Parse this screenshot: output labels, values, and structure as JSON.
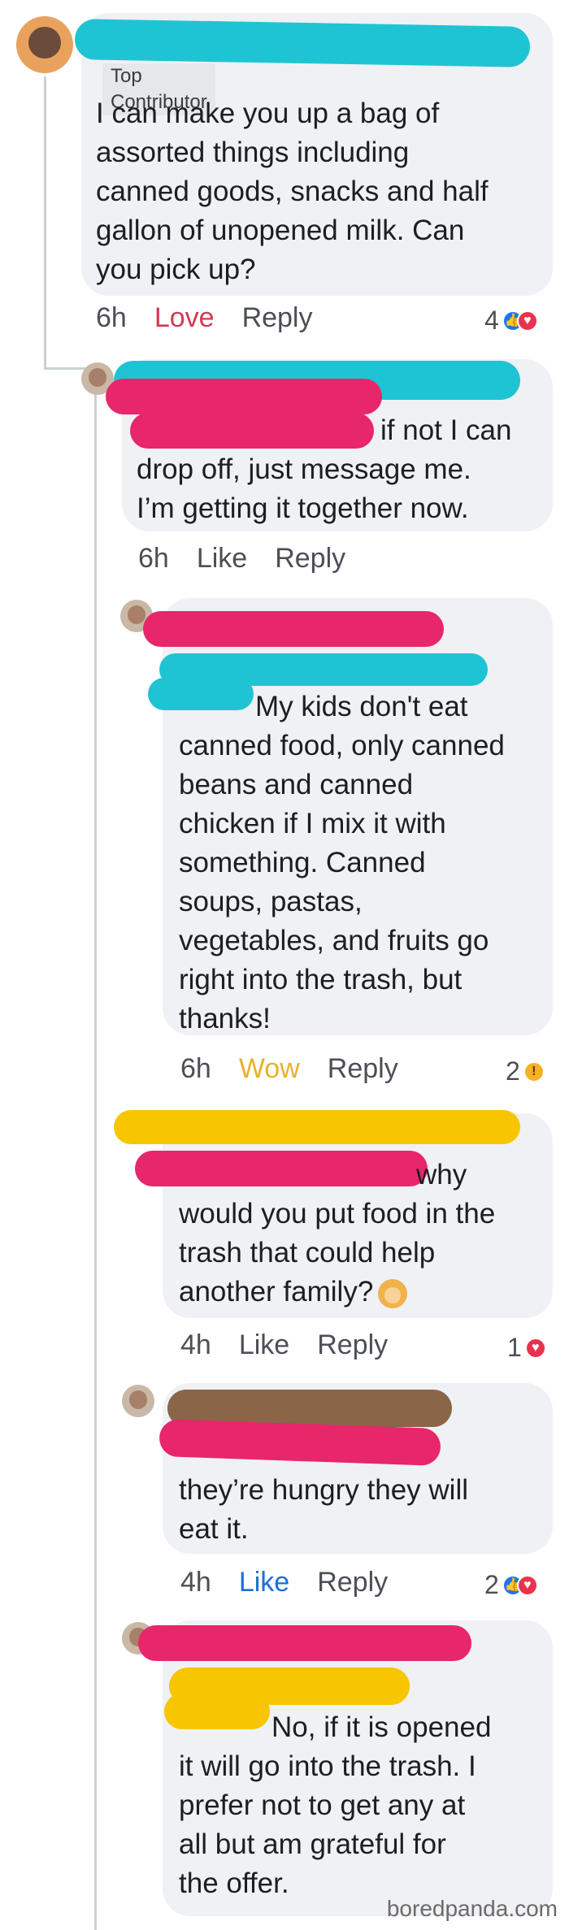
{
  "comments": [
    {
      "badge": "Top Contributor",
      "lines": [
        "I can make you up a bag of",
        "assorted things including",
        "canned goods, snacks and half",
        "gallon of unopened milk. Can",
        "you pick up?"
      ],
      "time": "6h",
      "reaction_action": "Love",
      "reply": "Reply",
      "count": "4"
    },
    {
      "lines": [
        "if not I can",
        "drop off, just message me.",
        "I’m getting it together now."
      ],
      "time": "6h",
      "reaction_action": "Like",
      "reply": "Reply"
    },
    {
      "lines": [
        "My kids don't eat",
        "canned food, only canned",
        "beans and canned",
        "chicken if I mix it with",
        "something. Canned",
        "soups, pastas,",
        "vegetables, and fruits go",
        "right into the trash, but",
        "thanks!"
      ],
      "time": "6h",
      "reaction_action": "Wow",
      "reply": "Reply",
      "count": "2"
    },
    {
      "lines": [
        "why",
        "would you put food in the",
        "trash that could help",
        "another family?"
      ],
      "time": "4h",
      "reaction_action": "Like",
      "reply": "Reply",
      "count": "1"
    },
    {
      "lines": [
        "they’re hungry they will",
        "eat it."
      ],
      "time": "4h",
      "reaction_action": "Like",
      "reply": "Reply",
      "count": "2"
    },
    {
      "lines": [
        "No, if it is opened",
        "it will go into the trash. I",
        "prefer not to get any at",
        "all but am grateful for",
        "the offer."
      ]
    }
  ],
  "watermark": "boredpanda.com",
  "colors": {
    "love": "#d23a51",
    "wow": "#e8b22a",
    "like_blue": "#1c6ed8",
    "bubble": "#eff1f4"
  }
}
